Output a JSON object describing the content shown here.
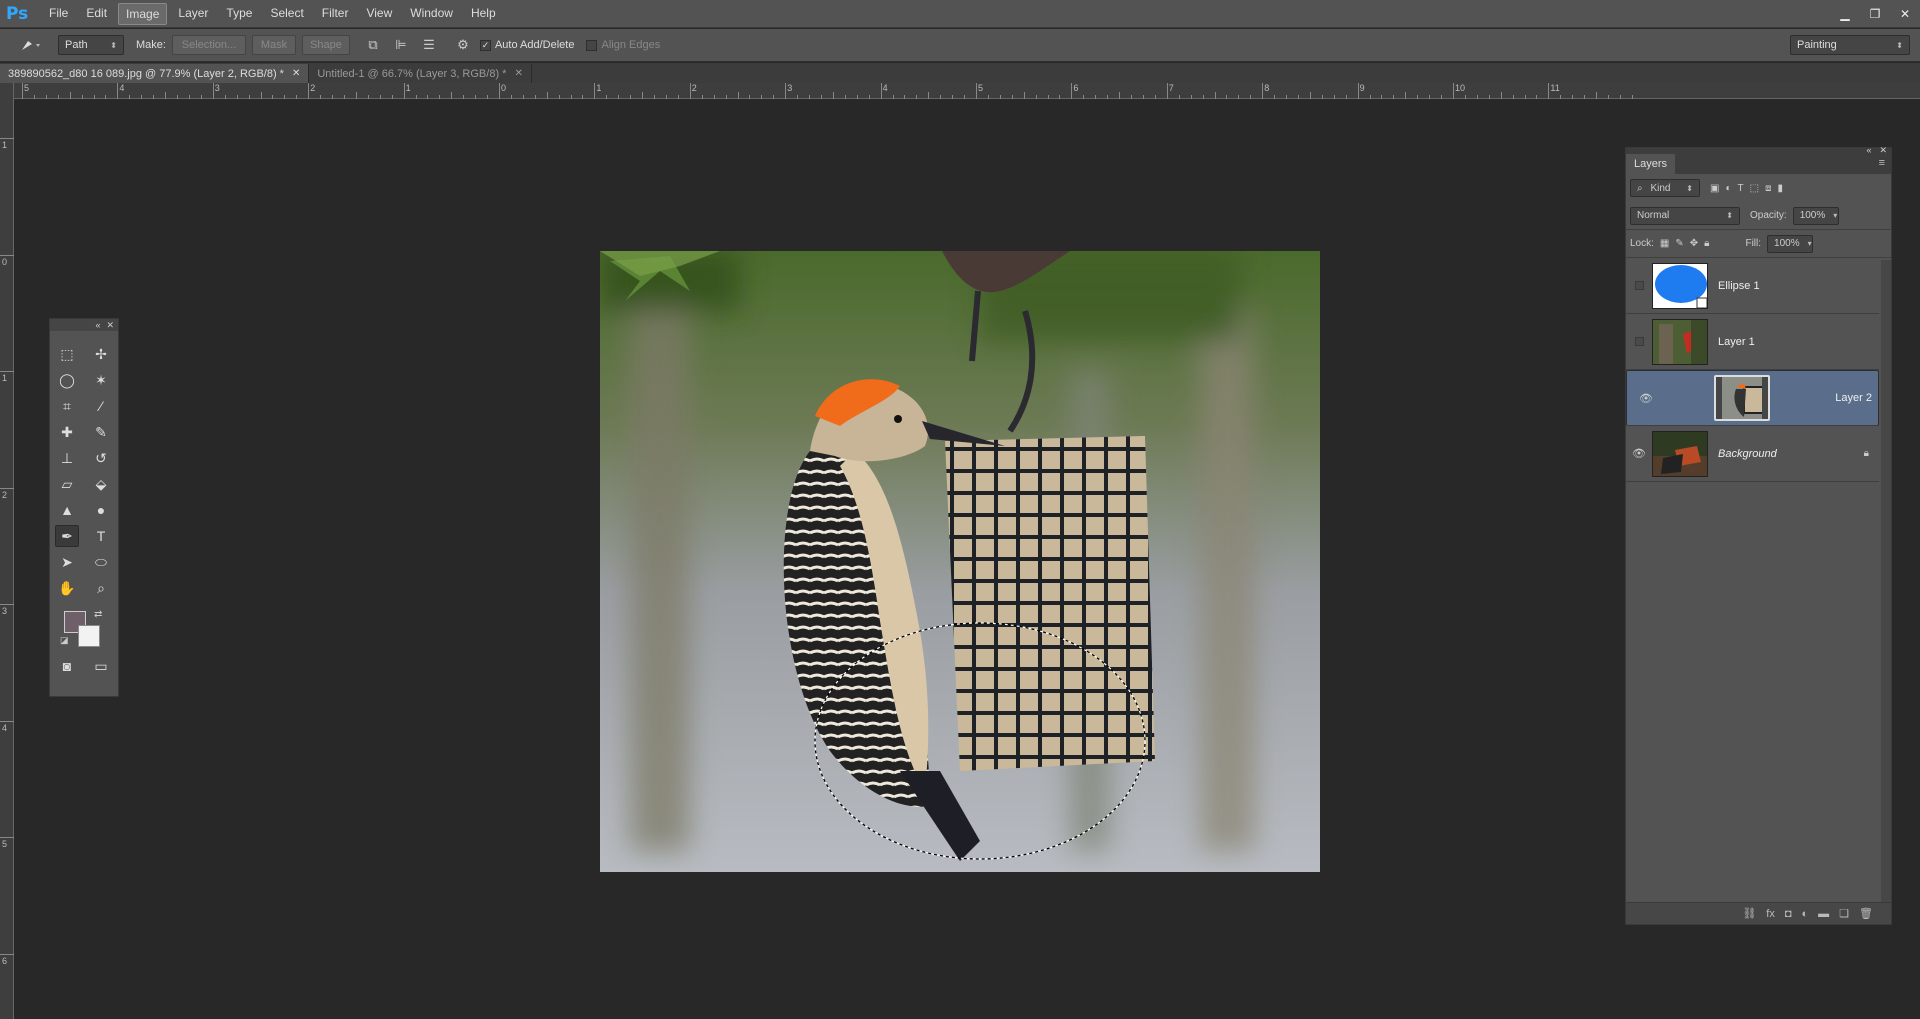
{
  "app": {
    "logo": "Ps"
  },
  "menu": [
    "File",
    "Edit",
    "Image",
    "Layer",
    "Type",
    "Select",
    "Filter",
    "View",
    "Window",
    "Help"
  ],
  "menu_active_index": 2,
  "window_controls": {
    "minimize": "▁",
    "restore": "❐",
    "close": "✕"
  },
  "options_bar": {
    "mode_value": "Path",
    "make_label": "Make:",
    "selection_label": "Selection...",
    "mask_label": "Mask",
    "shape_label": "Shape",
    "auto_add_delete_label": "Auto Add/Delete",
    "auto_add_delete_checked": true,
    "align_edges_label": "Align Edges",
    "align_edges_checked": false,
    "workspace_value": "Painting"
  },
  "tabs": [
    {
      "label": "389890562_d80 16 089.jpg @ 77.9% (Layer 2, RGB/8) *",
      "active": true
    },
    {
      "label": "Untitled-1 @ 66.7% (Layer 3, RGB/8) *",
      "active": false
    }
  ],
  "rulers": {
    "horizontal": [
      "5",
      "4",
      "3",
      "2",
      "1",
      "0",
      "1",
      "2",
      "3",
      "4",
      "5",
      "6",
      "7",
      "8",
      "9",
      "10",
      "11"
    ],
    "vertical": [
      "1",
      "0",
      "1",
      "2",
      "3",
      "4",
      "5",
      "6"
    ]
  },
  "toolbox": {
    "tools": [
      [
        "rectangular-marquee-icon",
        "move-icon"
      ],
      [
        "lasso-icon",
        "magic-wand-icon"
      ],
      [
        "crop-icon",
        "eyedropper-icon"
      ],
      [
        "healing-brush-icon",
        "brush-icon"
      ],
      [
        "clone-stamp-icon",
        "history-brush-icon"
      ],
      [
        "eraser-icon",
        "paint-bucket-icon"
      ],
      [
        "blur-icon",
        "dodge-icon"
      ],
      [
        "pen-icon",
        "type-icon"
      ],
      [
        "path-selection-icon",
        "ellipse-icon"
      ],
      [
        "hand-icon",
        "zoom-icon"
      ]
    ],
    "active_tool": "pen-icon",
    "foreground_color": "#6e5f68",
    "background_color": "#f2f2f2"
  },
  "layers_panel": {
    "tab_label": "Layers",
    "kind_label": "Kind",
    "blend_mode": "Normal",
    "opacity_label": "Opacity:",
    "opacity_value": "100%",
    "lock_label": "Lock:",
    "fill_label": "Fill:",
    "fill_value": "100%",
    "layers": [
      {
        "name": "Ellipse 1",
        "visible": false,
        "selected": false,
        "italic": false,
        "locked": false
      },
      {
        "name": "Layer 1",
        "visible": false,
        "selected": false,
        "italic": false,
        "locked": false
      },
      {
        "name": "Layer 2",
        "visible": true,
        "selected": true,
        "italic": false,
        "locked": false
      },
      {
        "name": "Background",
        "visible": true,
        "selected": false,
        "italic": true,
        "locked": true
      }
    ]
  },
  "colors": {
    "accent": "#31a8ff",
    "selected_layer": "#5a6e8c",
    "ellipse_fill": "#1e7bf0"
  }
}
